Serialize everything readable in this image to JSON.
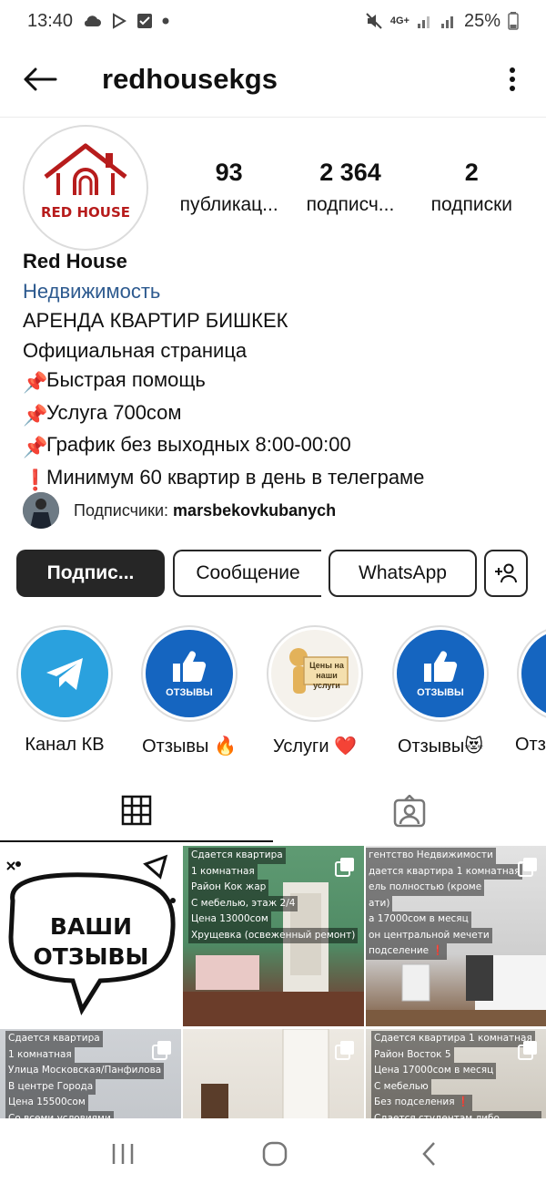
{
  "status_bar": {
    "time": "13:40",
    "network": "4G+",
    "battery": "25%"
  },
  "header": {
    "username": "redhousekgs"
  },
  "profile": {
    "avatar_text": "RED HOUSE",
    "stats": [
      {
        "value": "93",
        "label": "публикац..."
      },
      {
        "value": "2 364",
        "label": "подписч..."
      },
      {
        "value": "2",
        "label": "подписки"
      }
    ],
    "name": "Red House",
    "category": "Недвижимость",
    "bio_lines": [
      "АРЕНДА КВАРТИР БИШКЕК",
      "Официальная страница",
      "Быстрая помощь",
      "Услуга 700сом",
      "График без выходных 8:00-00:00",
      "Минимум 60 квартир в день в телеграме"
    ],
    "followers_prefix": "Подписчики:",
    "followers_user": "marsbekovkubanych"
  },
  "actions": {
    "follow": "Подпис...",
    "message": "Сообщение",
    "whatsapp": "WhatsApp"
  },
  "highlights": [
    {
      "label": "Канал КВ",
      "icon": "telegram-icon"
    },
    {
      "label": "Отзывы 🔥",
      "icon": "thumbs-up-icon",
      "badge": "ОТЗЫВЫ"
    },
    {
      "label": "Услуги ❤️",
      "icon": "services-figure",
      "badge": "Цены на наши услуги"
    },
    {
      "label": "Отзывы😻",
      "icon": "thumbs-up-icon",
      "badge": "ОТЗЫВЫ"
    },
    {
      "label": "Отз",
      "icon": "thumbs-up-icon"
    }
  ],
  "tabs": {
    "grid": "grid-icon",
    "tagged": "tagged-icon"
  },
  "posts": [
    {
      "headline": "ВАШИ ОТЗЫВЫ",
      "lines": []
    },
    {
      "lines": [
        "Сдается квартира",
        "1 комнатная",
        "Район Кок жар",
        "С мебелью, этаж 2/4",
        "Цена 13000сом",
        "Хрущевка (освеженный ремонт)"
      ]
    },
    {
      "lines": [
        "гентство Недвижимости",
        "дается квартира 1 комнатная",
        "ель полностью (кроме",
        "ати)",
        "а 17000сом в месяц",
        "он центральной мечети",
        "подселение ❗"
      ]
    },
    {
      "lines": [
        "Сдается квартира",
        "1 комнатная",
        "Улица Московская/Панфилова",
        "В центре Города",
        "Цена 15500сом",
        "Со всеми условиями"
      ]
    },
    {
      "lines": []
    },
    {
      "lines": [
        "Сдается квартира 1 комнатная",
        "Район Восток 5",
        "Цена 17000сом в месяц",
        "С мебелью",
        "Без подселения ❗",
        "Сдается студентам либо семьям"
      ]
    }
  ],
  "colors": {
    "accent_link": "#2d5a8f",
    "telegram": "#2aa1de",
    "reviews_blue": "#1565c0",
    "brand_red": "#b71c1c"
  }
}
